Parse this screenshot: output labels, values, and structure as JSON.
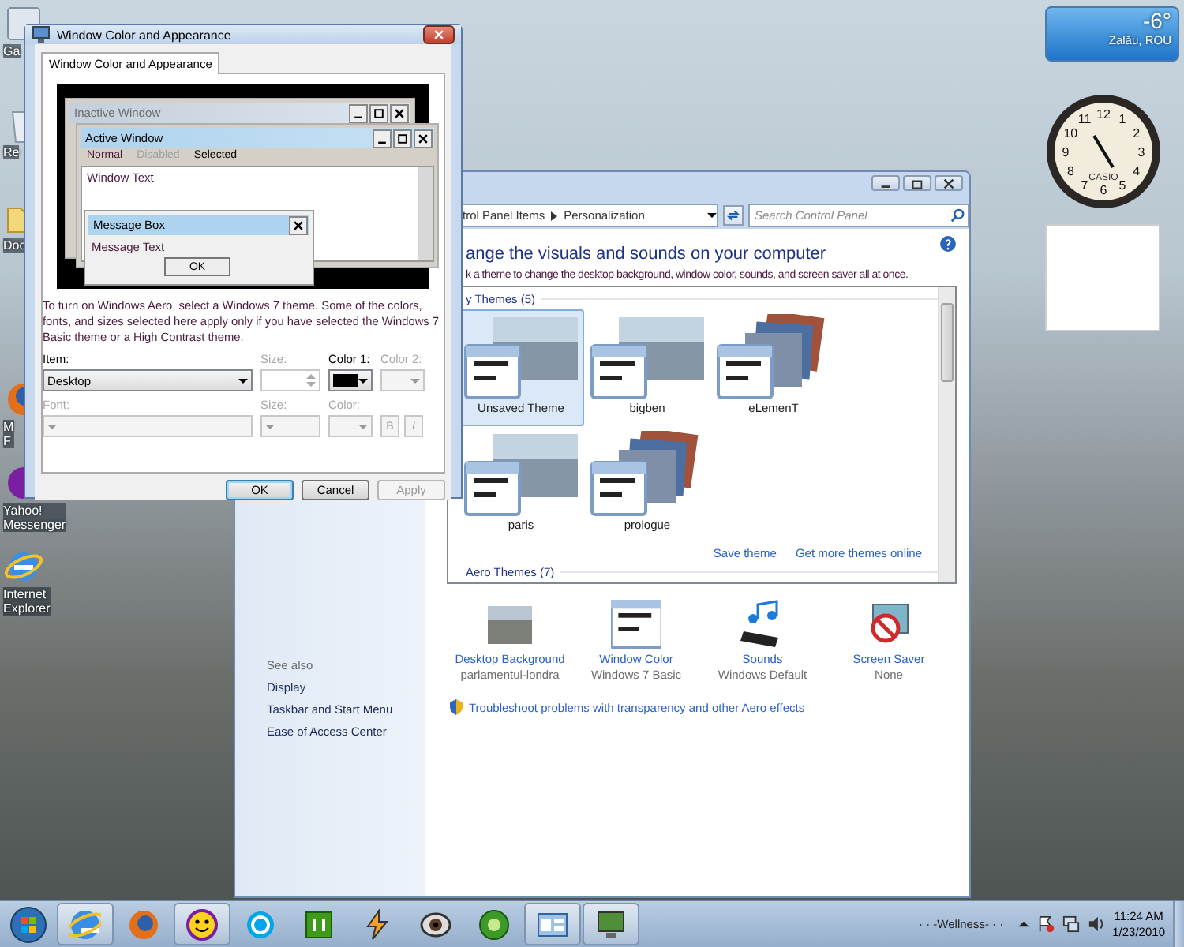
{
  "desktop_icons": [
    {
      "kind": "gadget",
      "lines": [
        "Ga"
      ]
    },
    {
      "kind": "bin",
      "lines": [
        "Re"
      ]
    },
    {
      "kind": "folder",
      "lines": [
        "Doc"
      ]
    },
    {
      "kind": "firefox",
      "lines": [
        "M",
        "F"
      ]
    },
    {
      "kind": "yahoo",
      "lines": [
        "Yahoo!",
        "Messenger"
      ]
    },
    {
      "kind": "ie",
      "lines": [
        "Internet",
        "Explorer"
      ]
    }
  ],
  "dialog": {
    "title": "Window Color and Appearance",
    "tabs": [
      {
        "label": "Window Color and Appearance",
        "selected": true
      }
    ],
    "preview": {
      "inactive_title": "Inactive Window",
      "active_title": "Active Window",
      "menu": [
        {
          "label": "Normal",
          "kind": "normal"
        },
        {
          "label": "Disabled",
          "kind": "disabled"
        },
        {
          "label": "Selected",
          "kind": "selected"
        }
      ],
      "window_text": "Window Text",
      "message_title": "Message Box",
      "message_text": "Message Text",
      "ok": "OK"
    },
    "note": "To turn on Windows Aero, select a Windows 7 theme.  Some of the colors, fonts, and sizes selected here apply only if you have selected the Windows 7 Basic theme or a High Contrast theme.",
    "rows": [
      [
        {
          "label": "Item:",
          "kind": "select",
          "value": "Desktop",
          "disabled": false
        },
        {
          "label": "Size:",
          "kind": "spinner",
          "disabled": true
        },
        {
          "label": "Color 1:",
          "kind": "color",
          "color": "#000000",
          "disabled": false
        },
        {
          "label": "Color 2:",
          "kind": "color",
          "disabled": true
        }
      ],
      [
        {
          "label": "Font:",
          "kind": "select",
          "disabled": true
        },
        {
          "label": "Size:",
          "kind": "select",
          "disabled": true
        },
        {
          "label": "Color:",
          "kind": "color",
          "disabled": true
        },
        {
          "kind": "style_buttons",
          "buttons": [
            "B",
            "I"
          ],
          "disabled": true
        }
      ]
    ],
    "buttons": [
      {
        "label": "OK",
        "default": true,
        "disabled": false
      },
      {
        "label": "Cancel",
        "default": false,
        "disabled": false
      },
      {
        "label": "Apply",
        "default": false,
        "disabled": true
      }
    ]
  },
  "personalization": {
    "breadcrumb": [
      "trol Panel Items",
      "Personalization"
    ],
    "search_placeholder": "Search Control Panel",
    "heading": "ange the visuals and sounds on your computer",
    "subtitle": "k a theme to change the desktop background, window color, sounds, and screen saver all at once.",
    "my_themes": {
      "title": "y Themes (5)",
      "themes": [
        {
          "label": "Unsaved Theme",
          "kind": "single",
          "selected": true
        },
        {
          "label": "bigben",
          "kind": "single",
          "selected": false
        },
        {
          "label": "eLemenT",
          "kind": "stack",
          "selected": false
        },
        {
          "label": "paris",
          "kind": "single",
          "selected": false
        },
        {
          "label": "prologue",
          "kind": "stack",
          "selected": false
        }
      ]
    },
    "links": [
      "Save theme",
      "Get more themes online"
    ],
    "aero_title": "Aero Themes (7)",
    "settings": [
      {
        "title": "Desktop Background",
        "value": "parlamentul-londra",
        "kind": "photo"
      },
      {
        "title": "Window Color",
        "value": "Windows 7 Basic",
        "kind": "window"
      },
      {
        "title": "Sounds",
        "value": "Windows Default",
        "kind": "sounds"
      },
      {
        "title": "Screen Saver",
        "value": "None",
        "kind": "screensaver"
      }
    ],
    "troubleshoot": "Troubleshoot problems with transparency and other Aero effects",
    "see_also": {
      "title": "See also",
      "links": [
        "Display",
        "Taskbar and Start Menu",
        "Ease of Access Center"
      ]
    }
  },
  "weather": {
    "temperature": "-6°",
    "location": "Zalău, ROU"
  },
  "clock": {
    "brand": "CASIO",
    "numbers": [
      "12",
      "11",
      "1",
      "10",
      "2",
      "9",
      "3",
      "8",
      "4",
      "7",
      "5",
      "6"
    ]
  },
  "taskbar": {
    "items": [
      {
        "kind": "ie",
        "open": true
      },
      {
        "kind": "firefox",
        "open": false
      },
      {
        "kind": "yahoo",
        "open": true
      },
      {
        "kind": "skype",
        "open": false
      },
      {
        "kind": "utorrent",
        "open": false
      },
      {
        "kind": "winamp",
        "open": false
      },
      {
        "kind": "eye",
        "open": false
      },
      {
        "kind": "mediacenter",
        "open": false
      },
      {
        "kind": "controlpanel",
        "open": true
      },
      {
        "kind": "display",
        "open": true
      }
    ],
    "media_text": "· · -Wellness- · ·",
    "time": "11:24 AM",
    "date": "1/23/2010"
  }
}
